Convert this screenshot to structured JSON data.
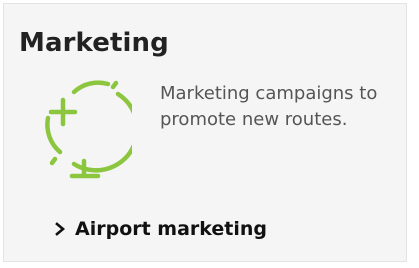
{
  "card": {
    "title": "Marketing",
    "description": "Marketing campaigns to promote new routes.",
    "icon": "globe-stand-icon",
    "link_label": "Airport marketing",
    "link_icon": "chevron-right-icon"
  },
  "colors": {
    "accent": "#8cc63f",
    "title": "#222222",
    "description": "#555555",
    "card_background": "#f5f5f5"
  }
}
